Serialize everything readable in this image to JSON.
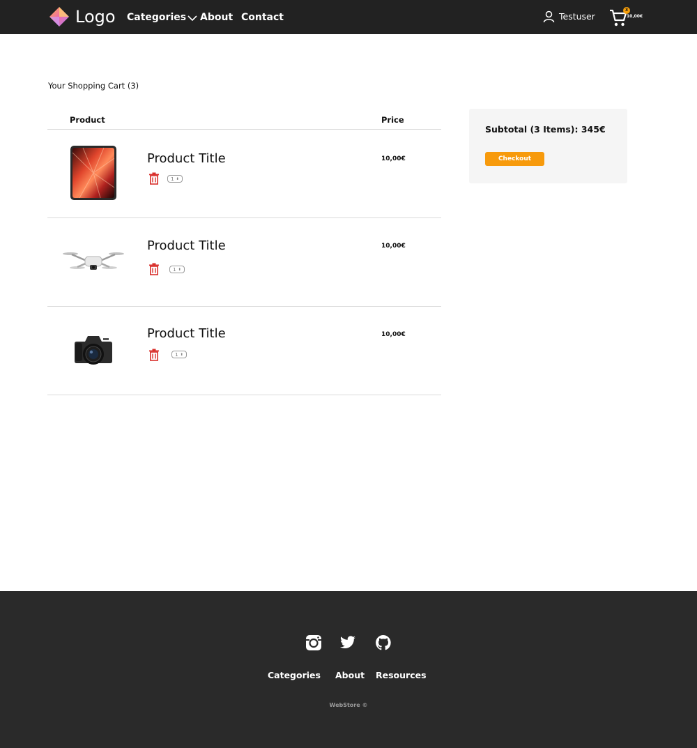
{
  "header": {
    "logo_text": "Logo",
    "nav": {
      "categories": "Categories",
      "about": "About",
      "contact": "Contact"
    },
    "user_name": "Testuser",
    "cart_count": "3",
    "cart_total": "10,00€"
  },
  "cart": {
    "title": "Your Shopping Cart (3)",
    "columns": {
      "product": "Product",
      "price": "Price"
    },
    "items": [
      {
        "title": "Product Title",
        "price": "10,00€",
        "qty": "1"
      },
      {
        "title": "Product Title",
        "price": "10,00€",
        "qty": "1"
      },
      {
        "title": "Product Title",
        "price": "10,00€",
        "qty": "1"
      }
    ]
  },
  "summary": {
    "subtotal": "Subtotal (3 Items): 345€",
    "checkout_label": "Checkout"
  },
  "footer": {
    "links": {
      "categories": "Categories",
      "about": "About",
      "resources": "Resources"
    },
    "copyright": "WebStore ©"
  },
  "colors": {
    "navbar": "#222222",
    "accent": "#f79a0c",
    "trash": "#d9302c",
    "footer": "#2a2a2a"
  }
}
